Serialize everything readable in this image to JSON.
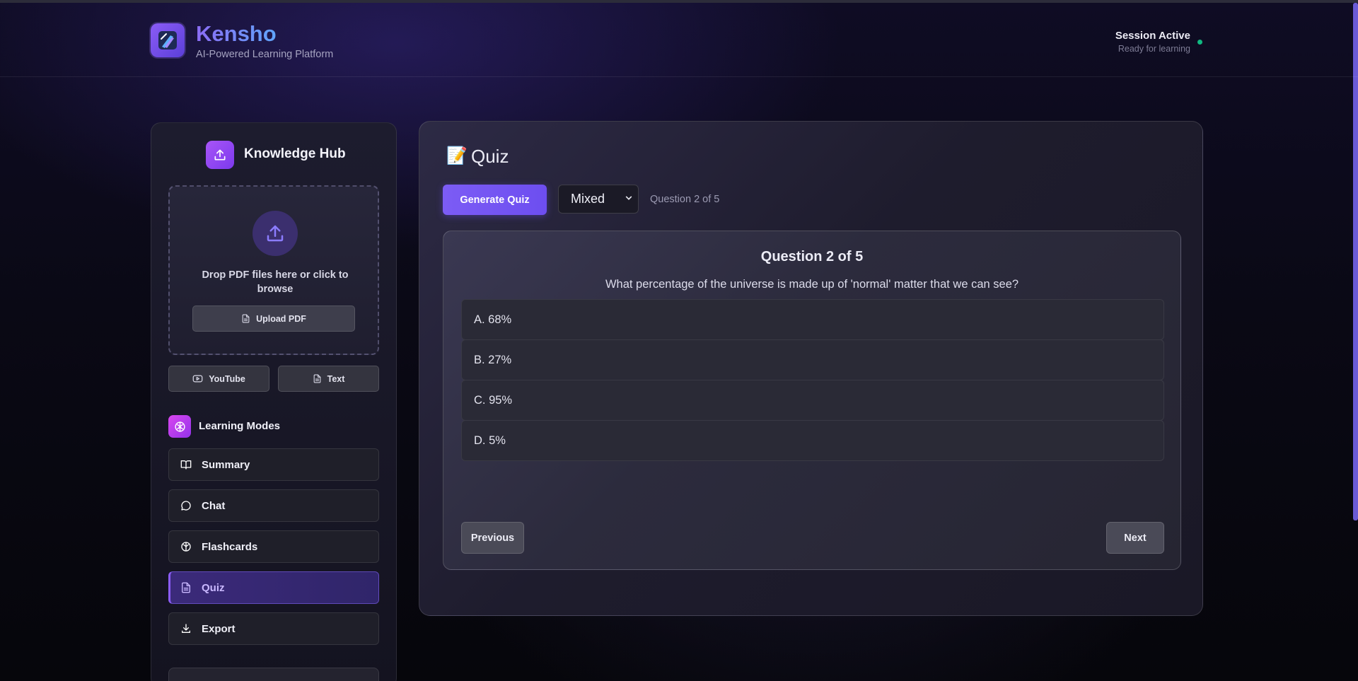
{
  "header": {
    "app_title": "Kensho",
    "app_subtitle": "AI-Powered Learning Platform",
    "session_title": "Session Active",
    "session_subtitle": "Ready for learning",
    "session_status_color": "#10b981"
  },
  "sidebar": {
    "title": "Knowledge Hub",
    "title_icon": "upload-icon",
    "dropzone": {
      "text": "Drop PDF files here or click to browse",
      "icon": "upload-icon",
      "button_label": "Upload PDF",
      "button_icon": "file-icon"
    },
    "sources": [
      {
        "label": "YouTube",
        "icon": "youtube-icon"
      },
      {
        "label": "Text",
        "icon": "file-icon"
      }
    ],
    "modes_title": "Learning Modes",
    "modes_icon": "brain-icon",
    "modes": [
      {
        "label": "Summary",
        "icon": "book-icon",
        "active": false
      },
      {
        "label": "Chat",
        "icon": "chat-icon",
        "active": false
      },
      {
        "label": "Flashcards",
        "icon": "brain-icon",
        "active": false
      },
      {
        "label": "Quiz",
        "icon": "file-icon",
        "active": true
      },
      {
        "label": "Export",
        "icon": "download-icon",
        "active": false
      }
    ]
  },
  "main": {
    "panel_title": "Quiz",
    "panel_icon": "memo-icon",
    "generate_button": "Generate Quiz",
    "question_type": "Mixed",
    "question_counter": "Question 2 of 5",
    "question": {
      "heading": "Question 2 of 5",
      "text": "What percentage of the universe is made up of 'normal' matter that we can see?",
      "options": [
        "A. 68%",
        "B. 27%",
        "C. 95%",
        "D. 5%"
      ]
    },
    "previous_button": "Previous",
    "next_button": "Next"
  },
  "colors": {
    "accent": "#7c5cf5",
    "background": "#0a0915"
  }
}
